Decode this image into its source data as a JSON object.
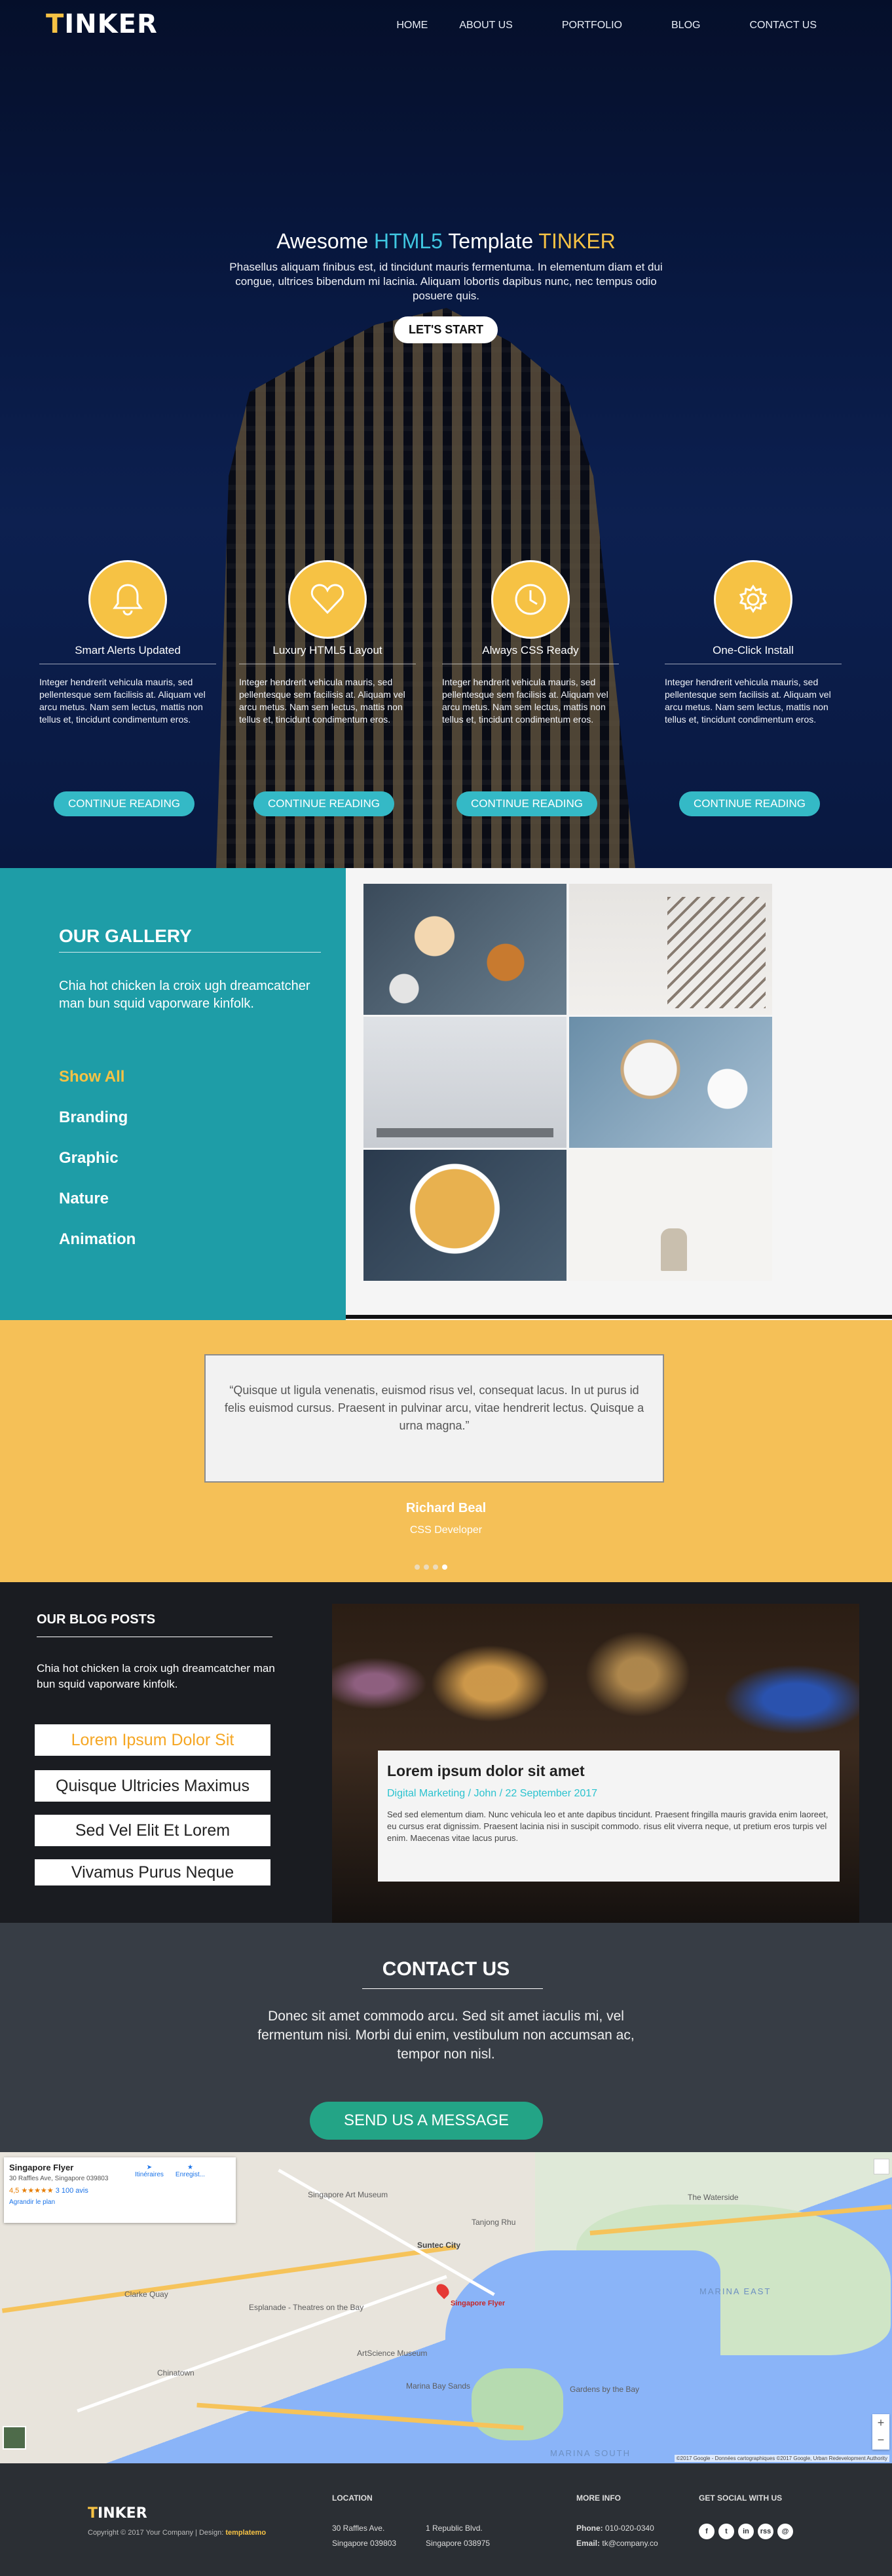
{
  "brand": {
    "first_letter": "T",
    "rest": "INKER"
  },
  "nav": [
    "HOME",
    "ABOUT US",
    "PORTFOLIO",
    "BLOG",
    "CONTACT US"
  ],
  "hero": {
    "title_a": "Awesome ",
    "title_b": "HTML5",
    "title_c": " Template ",
    "title_d": "TINKER",
    "text": "Phasellus aliquam finibus est, id tincidunt mauris fermentuma. In elementum diam et dui congue, ultrices bibendum mi lacinia. Aliquam lobortis dapibus nunc, nec tempus odio posuere quis.",
    "button": "LET'S START"
  },
  "features": [
    {
      "icon": "bell-icon",
      "title": "Smart Alerts Updated",
      "text": "Integer hendrerit vehicula mauris, sed pellentesque sem facilisis at. Aliquam vel arcu metus. Nam sem lectus, mattis non tellus et, tincidunt condimentum eros.",
      "button": "CONTINUE READING"
    },
    {
      "icon": "heart-icon",
      "title": "Luxury HTML5 Layout",
      "text": "Integer hendrerit vehicula mauris, sed pellentesque sem facilisis at. Aliquam vel arcu metus. Nam sem lectus, mattis non tellus et, tincidunt condimentum eros.",
      "button": "CONTINUE READING"
    },
    {
      "icon": "clock-icon",
      "title": "Always CSS Ready",
      "text": "Integer hendrerit vehicula mauris, sed pellentesque sem facilisis at. Aliquam vel arcu metus. Nam sem lectus, mattis non tellus et, tincidunt condimentum eros.",
      "button": "CONTINUE READING"
    },
    {
      "icon": "gear-icon",
      "title": "One-Click Install",
      "text": "Integer hendrerit vehicula mauris, sed pellentesque sem facilisis at. Aliquam vel arcu metus. Nam sem lectus, mattis non tellus et, tincidunt condimentum eros.",
      "button": "CONTINUE READING"
    }
  ],
  "gallery": {
    "title": "OUR GALLERY",
    "text": "Chia hot chicken la croix ugh dreamcatcher man bun squid vaporware kinfolk.",
    "filters": [
      "Show All",
      "Branding",
      "Graphic",
      "Nature",
      "Animation"
    ],
    "active_filter": "Show All"
  },
  "testimonial": {
    "quote": "Quisque ut ligula venenatis, euismod risus vel, consequat lacus. In ut purus id felis euismod cursus. Praesent in pulvinar arcu, vitae hendrerit lectus. Quisque a urna magna.",
    "name": "Richard Beal",
    "role": "CSS Developer",
    "slide_count": 4,
    "active_slide": 4
  },
  "blog": {
    "title": "OUR BLOG POSTS",
    "text": "Chia hot chicken la croix ugh dreamcatcher man bun squid vaporware kinfolk.",
    "posts": [
      "Lorem Ipsum Dolor Sit",
      "Quisque Ultricies Maximus",
      "Sed Vel Elit Et Lorem",
      "Vivamus Purus Neque"
    ],
    "card": {
      "title": "Lorem ipsum dolor sit amet",
      "meta": "Digital Marketing / John / 22 September 2017",
      "body": "Sed sed elementum diam. Nunc vehicula leo et ante dapibus tincidunt. Praesent fringilla mauris gravida enim laoreet, eu cursus erat dignissim. Praesent lacinia nisi in suscipit commodo. risus elit viverra neque, ut pretium eros turpis vel enim. Maecenas vitae lacus purus."
    }
  },
  "contact": {
    "title": "CONTACT US",
    "text": "Donec sit amet commodo arcu. Sed sit amet iaculis mi, vel fermentum nisi. Morbi dui enim, vestibulum non accumsan ac, tempor non nisl.",
    "button": "SEND US A MESSAGE"
  },
  "map": {
    "place": "Singapore Flyer",
    "address": "30 Raffles Ave, Singapore 039803",
    "rating": "4,5 ★★★★★",
    "reviews": "3 100 avis",
    "enlarge": "Agrandir le plan",
    "directions": "Itinéraires",
    "save": "Enregist...",
    "labels": [
      "Suntec City",
      "MARINA EAST",
      "Gardens by the Bay",
      "Marina Bay Sands",
      "ArtScience Museum",
      "Clarke Quay",
      "The Waterside",
      "Singapore Art Museum",
      "Esplanade - Theatres on the Bay",
      "Chinatown",
      "Tanjong Rhu",
      "MARINA SOUTH"
    ],
    "attribution": "©2017 Google - Données cartographiques ©2017 Google, Urban Redevelopment Authority"
  },
  "footer": {
    "copyright": "Copyright © 2017 Your Company | Design: ",
    "designer": "templatemo",
    "location_title": "LOCATION",
    "loc1_line1": "30 Raffles Ave.",
    "loc1_line2": "Singapore 039803",
    "loc2_line1": "1 Republic Blvd.",
    "loc2_line2": "Singapore 038975",
    "info_title": "MORE INFO",
    "phone_label": "Phone:",
    "phone": "010-020-0340",
    "email_label": "Email:",
    "email": "tk@company.co",
    "social_title": "GET SOCIAL WITH US",
    "socials": [
      "f",
      "t",
      "in",
      "rss",
      "@"
    ]
  },
  "colors": {
    "accent_yellow": "#f6c244",
    "teal": "#1e9da7",
    "cyan": "#3fc6e0",
    "green_button": "#23a486"
  }
}
